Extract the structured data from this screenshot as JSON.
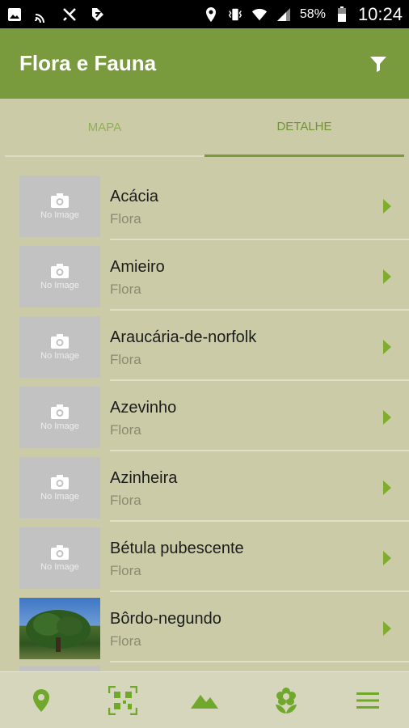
{
  "status_bar": {
    "battery": "58%",
    "time": "10:24",
    "icons": [
      "image-icon",
      "cast-icon",
      "no-gps-icon",
      "tag-icon",
      "location-icon",
      "vibrate-icon",
      "wifi-icon",
      "signal-icon",
      "battery-icon"
    ]
  },
  "app_bar": {
    "title": "Flora e Fauna",
    "filter_icon": "filter-icon"
  },
  "tabs": [
    {
      "label": "MAPA",
      "active": false
    },
    {
      "label": "DETALHE",
      "active": true
    }
  ],
  "placeholder": {
    "no_image": "No Image"
  },
  "items": [
    {
      "name": "Acácia",
      "category": "Flora",
      "has_photo": false
    },
    {
      "name": "Amieiro",
      "category": "Flora",
      "has_photo": false
    },
    {
      "name": "Araucária-de-norfolk",
      "category": "Flora",
      "has_photo": false
    },
    {
      "name": "Azevinho",
      "category": "Flora",
      "has_photo": false
    },
    {
      "name": "Azinheira",
      "category": "Flora",
      "has_photo": false
    },
    {
      "name": "Bétula pubescente",
      "category": "Flora",
      "has_photo": false
    },
    {
      "name": "Bôrdo-negundo",
      "category": "Flora",
      "has_photo": true
    }
  ],
  "bottom_nav": [
    "location-pin-icon",
    "qr-code-icon",
    "mountains-icon",
    "flower-icon",
    "menu-icon"
  ],
  "colors": {
    "primary": "#7a9a3e",
    "accent": "#7fae2f",
    "background": "#cbcca7"
  }
}
